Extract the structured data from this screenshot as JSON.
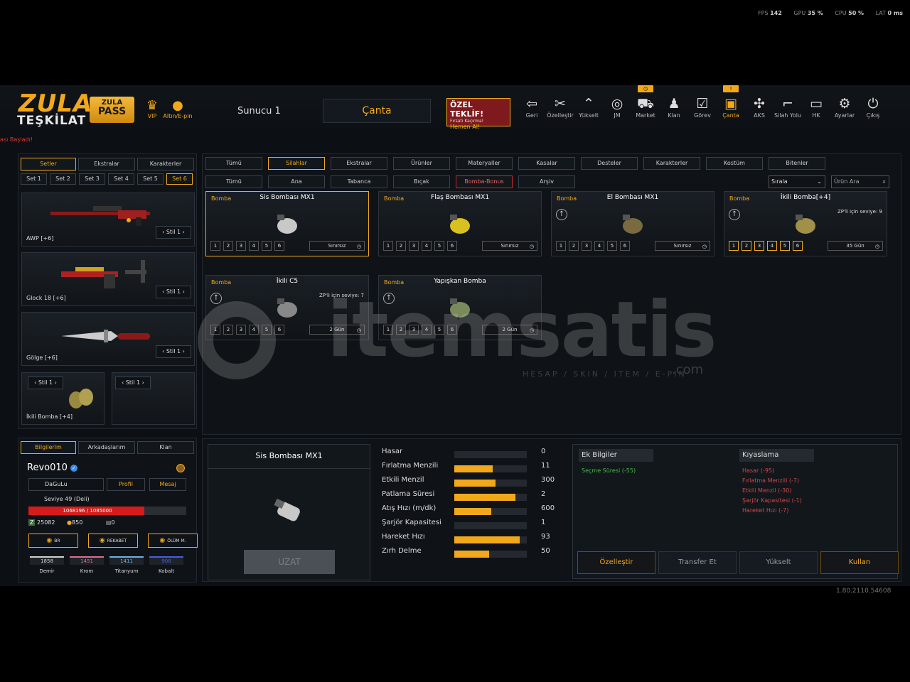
{
  "perf": {
    "fps_label": "FPS",
    "fps": "142",
    "gpu_label": "GPU",
    "gpu": "35 %",
    "cpu_label": "CPU",
    "cpu": "50 %",
    "lat_label": "LAT",
    "lat": "0 ms"
  },
  "header": {
    "logo_top": "ZULA",
    "logo_bottom": "TEŞKİLAT",
    "pass_top": "ZULA",
    "pass_bottom": "PASS",
    "vip": "VIP",
    "altin": "Altın/E-pin",
    "server": "Sunucu 1",
    "canta_button": "Çanta",
    "offer_title": "ÖZEL TEKLİF!",
    "offer_sub": "Fırsatı Kaçırma!",
    "offer_cta": "Hemen Al!",
    "status": "ası Başladı!"
  },
  "nav": [
    {
      "label": "Geri",
      "icon": "exit-icon",
      "glyph": "⇦"
    },
    {
      "label": "Özelleştir",
      "icon": "tools-icon",
      "glyph": "✂"
    },
    {
      "label": "Yükselt",
      "icon": "upgrade-icon",
      "glyph": "⌃"
    },
    {
      "label": "JM",
      "icon": "coins-icon",
      "glyph": "◎"
    },
    {
      "label": "Market",
      "icon": "cart-icon",
      "glyph": "⛟",
      "badge": "◷"
    },
    {
      "label": "Klan",
      "icon": "clan-icon",
      "glyph": "♟"
    },
    {
      "label": "Görev",
      "icon": "task-icon",
      "glyph": "☑"
    },
    {
      "label": "Çanta",
      "icon": "bag-icon",
      "glyph": "▣",
      "badge": "!"
    },
    {
      "label": "AKS",
      "icon": "sight-icon",
      "glyph": "✣"
    },
    {
      "label": "Silah Yolu",
      "icon": "gun-icon",
      "glyph": "⌐"
    },
    {
      "label": "HK",
      "icon": "hk-icon",
      "glyph": "▭"
    },
    {
      "label": "Ayarlar",
      "icon": "gear-icon",
      "glyph": "⚙"
    },
    {
      "label": "Çıkış",
      "icon": "power-icon",
      "glyph": "⏻"
    }
  ],
  "left": {
    "tabs": [
      "Setler",
      "Ekstralar",
      "Karakterler"
    ],
    "sets": [
      "Set 1",
      "Set 2",
      "Set 3",
      "Set 4",
      "Set 5",
      "Set 6"
    ],
    "stil": "Stil 1",
    "weapons": [
      {
        "name": "AWP [+6]"
      },
      {
        "name": "Glock 18 [+6]"
      },
      {
        "name": "Gölge [+6]"
      }
    ],
    "small_weapon": "İkili Bomba [+4]"
  },
  "profile": {
    "tabs": [
      "Bilgilerim",
      "Arkadaşlarım",
      "Klan"
    ],
    "name": "Revo010",
    "clan": "DaGuLu",
    "profil_btn": "Profil",
    "mesaj_btn": "Mesaj",
    "level": "Seviye 49 (Deli)",
    "xp": "1068196 / 1085000",
    "xp_fraction": 0.98,
    "zp": "25082",
    "gold": "850",
    "other": "0",
    "ranks": [
      {
        "label": "BR"
      },
      {
        "label": "REKABET"
      },
      {
        "label": "ÖLÜM M."
      }
    ],
    "resources": [
      {
        "value": "1858",
        "name": "Demir",
        "color": "#d0d0d0"
      },
      {
        "value": "1451",
        "name": "Krom",
        "color": "#d87090"
      },
      {
        "value": "1411",
        "name": "Titanyum",
        "color": "#70b0e0"
      },
      {
        "value": "908",
        "name": "Kobalt",
        "color": "#4060e0"
      }
    ]
  },
  "filters": {
    "top": [
      "Tümü",
      "Silahlar",
      "Ekstralar",
      "Ürünler",
      "Materyaller",
      "Kasalar",
      "Desteler",
      "Karakterler",
      "Kostüm",
      "Bitenler"
    ],
    "sub": [
      "Tümü",
      "Ana",
      "Tabanca",
      "Bıçak",
      "Bomba-Bonus",
      "Arşiv"
    ],
    "sort": "Sırala",
    "search_placeholder": "Ürün Ara"
  },
  "items": [
    {
      "cat": "Bomba",
      "title": "Sis Bombası MX1",
      "levels": [
        "1",
        "2",
        "3",
        "4",
        "5",
        "6"
      ],
      "dur": "Sınırsız",
      "sub": "",
      "up": false
    },
    {
      "cat": "Bomba",
      "title": "Flaş Bombası MX1",
      "levels": [
        "1",
        "2",
        "3",
        "4",
        "5",
        "6"
      ],
      "dur": "Sınırsız",
      "sub": "",
      "up": false
    },
    {
      "cat": "Bomba",
      "title": "El Bombası MX1",
      "levels": [
        "1",
        "2",
        "3",
        "4",
        "5",
        "6"
      ],
      "dur": "Sınırsız",
      "sub": "",
      "up": true
    },
    {
      "cat": "Bomba",
      "title": "İkili Bomba[+4]",
      "levels": [
        "1",
        "2",
        "3",
        "4",
        "5",
        "6"
      ],
      "dur": "35 Gün",
      "sub": "ZP'li için seviye: 9",
      "up": true
    },
    {
      "cat": "Bomba",
      "title": "İkili C5",
      "levels": [
        "1",
        "2",
        "3",
        "4",
        "5",
        "6"
      ],
      "dur": "2 Gün",
      "sub": "ZP'li için seviye: 7",
      "up": true
    },
    {
      "cat": "Bomba",
      "title": "Yapışkan Bomba",
      "levels": [
        "1",
        "2",
        "3",
        "4",
        "5",
        "6"
      ],
      "dur": "2 Gün",
      "sub": "",
      "up": true
    }
  ],
  "detail": {
    "title": "Sis Bombası MX1",
    "button": "UZAT"
  },
  "stats": [
    {
      "label": "Hasar",
      "value": "0",
      "fill": 0
    },
    {
      "label": "Fırlatma Menzili",
      "value": "11",
      "fill": 0.53
    },
    {
      "label": "Etkili Menzil",
      "value": "300",
      "fill": 0.57
    },
    {
      "label": "Patlama Süresi",
      "value": "2",
      "fill": 0.84
    },
    {
      "label": "Atış Hızı (m/dk)",
      "value": "600",
      "fill": 0.51
    },
    {
      "label": "Şarjör Kapasitesi",
      "value": "1",
      "fill": 0
    },
    {
      "label": "Hareket Hızı",
      "value": "93",
      "fill": 0.9
    },
    {
      "label": "Zırh Delme",
      "value": "50",
      "fill": 0.48
    }
  ],
  "extra": {
    "title": "Ek Bilgiler",
    "lines": [
      "Seçme Süresi (-55)"
    ]
  },
  "compare": {
    "title": "Kıyaslama",
    "lines": [
      "Hasar (-95)",
      "Fırlatma Menzili (-7)",
      "Etkili Menzil (-30)",
      "Şarjör Kapasitesi (-1)",
      "Hareket Hızı (-7)"
    ]
  },
  "actions": [
    "Özelleştir",
    "Transfer Et",
    "Yükselt",
    "Kullan"
  ],
  "watermark": {
    "brand": "itemsatis",
    "tagline": "HESAP / SKIN / ITEM / E-PIN",
    "com": ".com"
  },
  "version": "1.80.2110.54608",
  "colors": {
    "accent": "#f2a81b",
    "danger": "#c42a2a"
  }
}
